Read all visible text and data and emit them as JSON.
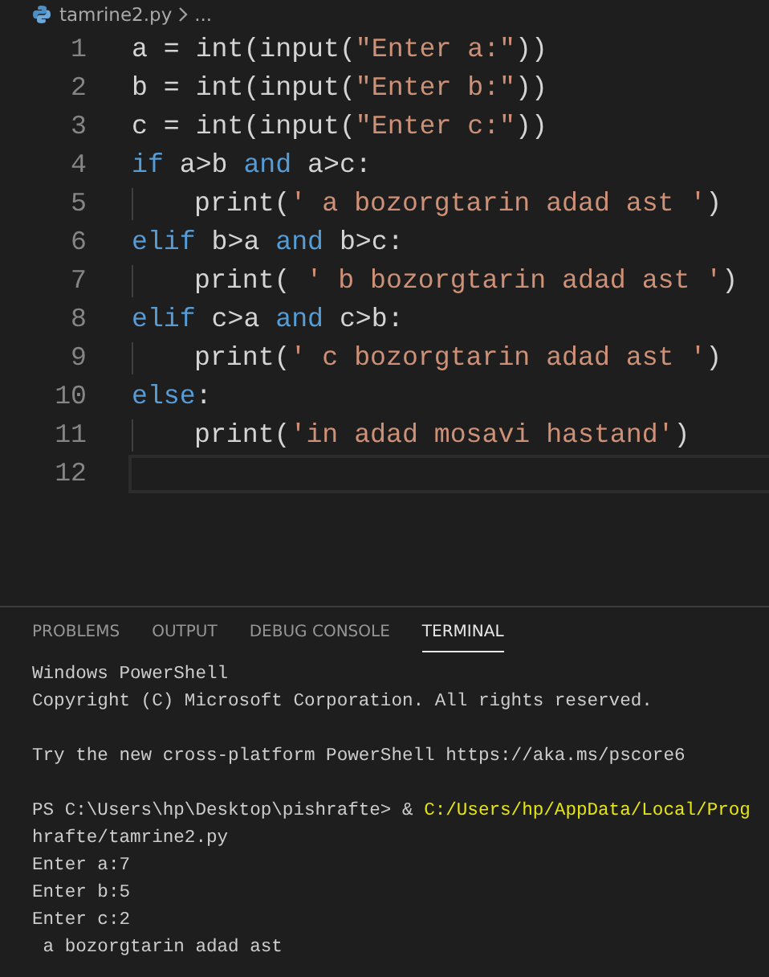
{
  "breadcrumb": {
    "file": "tamrine2.py",
    "more": "..."
  },
  "editor": {
    "lines": [
      {
        "number": "1",
        "indent": false,
        "current": false,
        "tokens": [
          {
            "kind": "plain",
            "text": "a = int(input("
          },
          {
            "kind": "string",
            "text": "\"Enter a:\""
          },
          {
            "kind": "plain",
            "text": "))"
          }
        ]
      },
      {
        "number": "2",
        "indent": false,
        "current": false,
        "tokens": [
          {
            "kind": "plain",
            "text": "b = int(input("
          },
          {
            "kind": "string",
            "text": "\"Enter b:\""
          },
          {
            "kind": "plain",
            "text": "))"
          }
        ]
      },
      {
        "number": "3",
        "indent": false,
        "current": false,
        "tokens": [
          {
            "kind": "plain",
            "text": "c = int(input("
          },
          {
            "kind": "string",
            "text": "\"Enter c:\""
          },
          {
            "kind": "plain",
            "text": "))"
          }
        ]
      },
      {
        "number": "4",
        "indent": false,
        "current": false,
        "tokens": [
          {
            "kind": "keyword",
            "text": "if"
          },
          {
            "kind": "plain",
            "text": " a>b "
          },
          {
            "kind": "keyword",
            "text": "and"
          },
          {
            "kind": "plain",
            "text": " a>c:"
          }
        ]
      },
      {
        "number": "5",
        "indent": true,
        "current": false,
        "tokens": [
          {
            "kind": "plain",
            "text": "print("
          },
          {
            "kind": "string",
            "text": "' a bozorgtarin adad ast '"
          },
          {
            "kind": "plain",
            "text": ")"
          }
        ]
      },
      {
        "number": "6",
        "indent": false,
        "current": false,
        "tokens": [
          {
            "kind": "keyword",
            "text": "elif"
          },
          {
            "kind": "plain",
            "text": " b>a "
          },
          {
            "kind": "keyword",
            "text": "and"
          },
          {
            "kind": "plain",
            "text": " b>c:"
          }
        ]
      },
      {
        "number": "7",
        "indent": true,
        "current": false,
        "tokens": [
          {
            "kind": "plain",
            "text": "print( "
          },
          {
            "kind": "string",
            "text": "' b bozorgtarin adad ast '"
          },
          {
            "kind": "plain",
            "text": ")"
          }
        ]
      },
      {
        "number": "8",
        "indent": false,
        "current": false,
        "tokens": [
          {
            "kind": "keyword",
            "text": "elif"
          },
          {
            "kind": "plain",
            "text": " c>a "
          },
          {
            "kind": "keyword",
            "text": "and"
          },
          {
            "kind": "plain",
            "text": " c>b:"
          }
        ]
      },
      {
        "number": "9",
        "indent": true,
        "current": false,
        "tokens": [
          {
            "kind": "plain",
            "text": "print("
          },
          {
            "kind": "string",
            "text": "' c bozorgtarin adad ast '"
          },
          {
            "kind": "plain",
            "text": ")"
          }
        ]
      },
      {
        "number": "10",
        "indent": false,
        "current": false,
        "tokens": [
          {
            "kind": "keyword",
            "text": "else"
          },
          {
            "kind": "plain",
            "text": ":"
          }
        ]
      },
      {
        "number": "11",
        "indent": true,
        "current": false,
        "tokens": [
          {
            "kind": "plain",
            "text": "print("
          },
          {
            "kind": "string",
            "text": "'in adad mosavi hastand'"
          },
          {
            "kind": "plain",
            "text": ")"
          }
        ]
      },
      {
        "number": "12",
        "indent": false,
        "current": true
      }
    ]
  },
  "panel": {
    "tabs": [
      {
        "label": "PROBLEMS",
        "selected": false
      },
      {
        "label": "OUTPUT",
        "selected": false
      },
      {
        "label": "DEBUG CONSOLE",
        "selected": false
      },
      {
        "label": "TERMINAL",
        "selected": true
      }
    ],
    "terminal": [
      {
        "lines": [
          [
            {
              "kind": "plain",
              "text": "Windows PowerShell"
            }
          ],
          [
            {
              "kind": "plain",
              "text": "Copyright (C) Microsoft Corporation. All rights reserved."
            }
          ]
        ]
      },
      {
        "lines": [
          [
            {
              "kind": "plain",
              "text": "Try the new cross-platform PowerShell https://aka.ms/pscore6"
            }
          ]
        ]
      },
      {
        "lines": [
          [
            {
              "kind": "plain",
              "text": "PS C:\\Users\\hp\\Desktop\\pishrafte> & "
            },
            {
              "kind": "path",
              "text": "C:/Users/hp/AppData/Local/Prog"
            }
          ],
          [
            {
              "kind": "plain",
              "text": "hrafte/tamrine2.py"
            }
          ],
          [
            {
              "kind": "plain",
              "text": "Enter a:7"
            }
          ],
          [
            {
              "kind": "plain",
              "text": "Enter b:5"
            }
          ],
          [
            {
              "kind": "plain",
              "text": "Enter c:2"
            }
          ],
          [
            {
              "kind": "plain",
              "text": " a bozorgtarin adad ast"
            }
          ]
        ]
      }
    ]
  }
}
